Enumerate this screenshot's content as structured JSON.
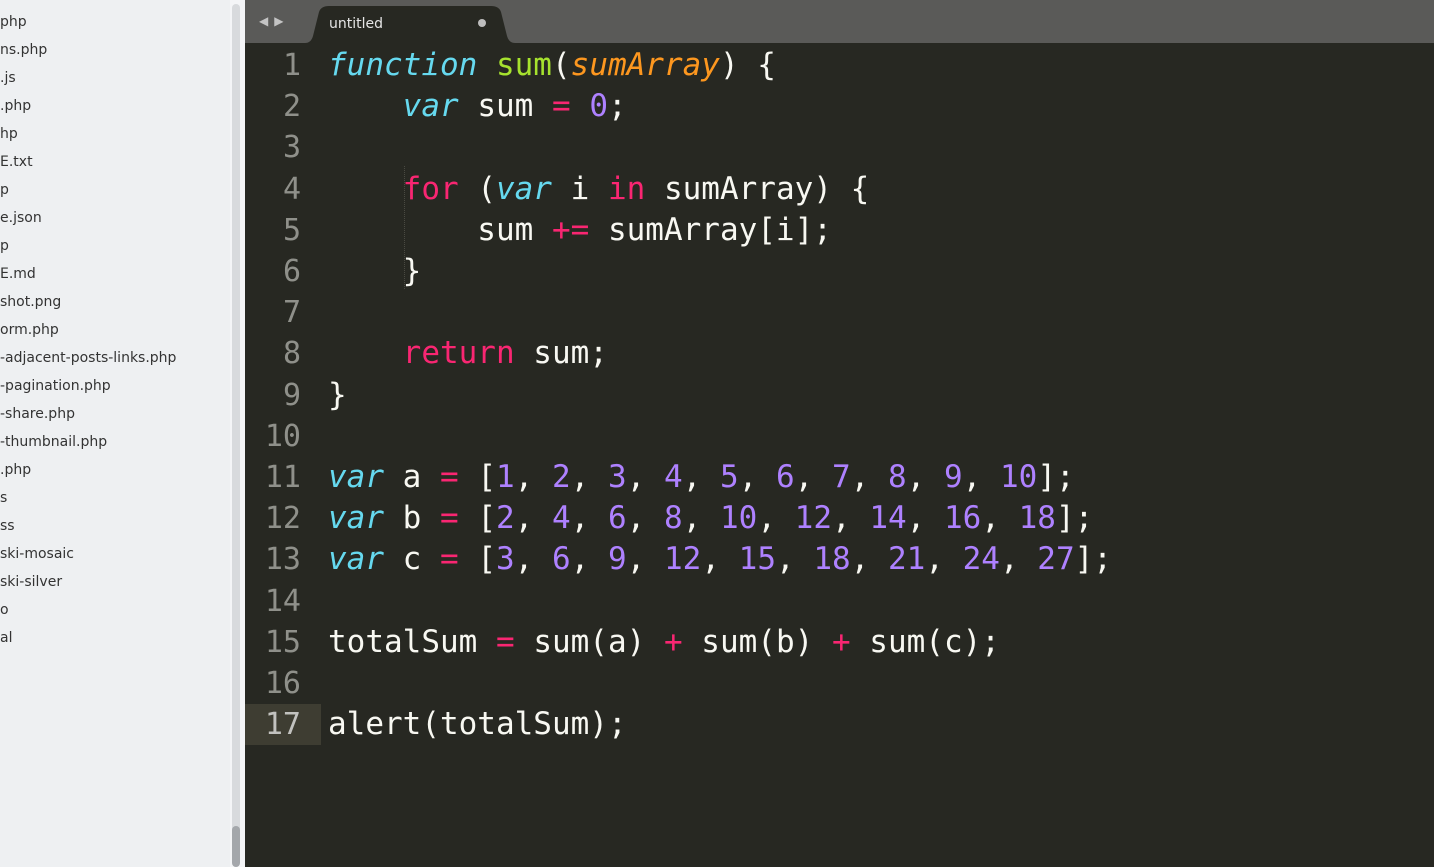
{
  "sidebar": {
    "items": [
      "php",
      "ns.php",
      ".js",
      ".php",
      "hp",
      "E.txt",
      "p",
      "e.json",
      "p",
      "E.md",
      "shot.png",
      "orm.php",
      "-adjacent-posts-links.php",
      "-pagination.php",
      "-share.php",
      "-thumbnail.php",
      ".php",
      "s",
      "ss",
      "ski-mosaic",
      "ski-silver",
      "o",
      "al"
    ]
  },
  "tabbar": {
    "back_arrow": "◀",
    "forward_arrow": "▶",
    "tab_title": "untitled",
    "tab_modified_icon": "dot-icon"
  },
  "editor": {
    "current_line": 17,
    "line_numbers": [
      "1",
      "2",
      "3",
      "4",
      "5",
      "6",
      "7",
      "8",
      "9",
      "10",
      "11",
      "12",
      "13",
      "14",
      "15",
      "16",
      "17"
    ],
    "lines": [
      [
        {
          "t": "function",
          "c": "kw-storage"
        },
        {
          "t": " "
        },
        {
          "t": "sum",
          "c": "fn"
        },
        {
          "t": "("
        },
        {
          "t": "sumArray",
          "c": "param"
        },
        {
          "t": ") {"
        }
      ],
      [
        {
          "t": "    "
        },
        {
          "t": "var",
          "c": "kw-storage"
        },
        {
          "t": " sum "
        },
        {
          "t": "=",
          "c": "op"
        },
        {
          "t": " "
        },
        {
          "t": "0",
          "c": "num"
        },
        {
          "t": ";"
        }
      ],
      [],
      [
        {
          "t": "    "
        },
        {
          "t": "for",
          "c": "kw"
        },
        {
          "t": " ("
        },
        {
          "t": "var",
          "c": "kw-storage"
        },
        {
          "t": " i "
        },
        {
          "t": "in",
          "c": "kw"
        },
        {
          "t": " sumArray) {"
        }
      ],
      [
        {
          "t": "        sum "
        },
        {
          "t": "+=",
          "c": "op"
        },
        {
          "t": " sumArray[i];"
        }
      ],
      [
        {
          "t": "    }"
        }
      ],
      [],
      [
        {
          "t": "    "
        },
        {
          "t": "return",
          "c": "kw"
        },
        {
          "t": " sum;"
        }
      ],
      [
        {
          "t": "}"
        }
      ],
      [],
      [
        {
          "t": "var",
          "c": "kw-storage"
        },
        {
          "t": " a "
        },
        {
          "t": "=",
          "c": "op"
        },
        {
          "t": " ["
        },
        {
          "t": "1",
          "c": "num"
        },
        {
          "t": ", "
        },
        {
          "t": "2",
          "c": "num"
        },
        {
          "t": ", "
        },
        {
          "t": "3",
          "c": "num"
        },
        {
          "t": ", "
        },
        {
          "t": "4",
          "c": "num"
        },
        {
          "t": ", "
        },
        {
          "t": "5",
          "c": "num"
        },
        {
          "t": ", "
        },
        {
          "t": "6",
          "c": "num"
        },
        {
          "t": ", "
        },
        {
          "t": "7",
          "c": "num"
        },
        {
          "t": ", "
        },
        {
          "t": "8",
          "c": "num"
        },
        {
          "t": ", "
        },
        {
          "t": "9",
          "c": "num"
        },
        {
          "t": ", "
        },
        {
          "t": "10",
          "c": "num"
        },
        {
          "t": "];"
        }
      ],
      [
        {
          "t": "var",
          "c": "kw-storage"
        },
        {
          "t": " b "
        },
        {
          "t": "=",
          "c": "op"
        },
        {
          "t": " ["
        },
        {
          "t": "2",
          "c": "num"
        },
        {
          "t": ", "
        },
        {
          "t": "4",
          "c": "num"
        },
        {
          "t": ", "
        },
        {
          "t": "6",
          "c": "num"
        },
        {
          "t": ", "
        },
        {
          "t": "8",
          "c": "num"
        },
        {
          "t": ", "
        },
        {
          "t": "10",
          "c": "num"
        },
        {
          "t": ", "
        },
        {
          "t": "12",
          "c": "num"
        },
        {
          "t": ", "
        },
        {
          "t": "14",
          "c": "num"
        },
        {
          "t": ", "
        },
        {
          "t": "16",
          "c": "num"
        },
        {
          "t": ", "
        },
        {
          "t": "18",
          "c": "num"
        },
        {
          "t": "];"
        }
      ],
      [
        {
          "t": "var",
          "c": "kw-storage"
        },
        {
          "t": " c "
        },
        {
          "t": "=",
          "c": "op"
        },
        {
          "t": " ["
        },
        {
          "t": "3",
          "c": "num"
        },
        {
          "t": ", "
        },
        {
          "t": "6",
          "c": "num"
        },
        {
          "t": ", "
        },
        {
          "t": "9",
          "c": "num"
        },
        {
          "t": ", "
        },
        {
          "t": "12",
          "c": "num"
        },
        {
          "t": ", "
        },
        {
          "t": "15",
          "c": "num"
        },
        {
          "t": ", "
        },
        {
          "t": "18",
          "c": "num"
        },
        {
          "t": ", "
        },
        {
          "t": "21",
          "c": "num"
        },
        {
          "t": ", "
        },
        {
          "t": "24",
          "c": "num"
        },
        {
          "t": ", "
        },
        {
          "t": "27",
          "c": "num"
        },
        {
          "t": "];"
        }
      ],
      [],
      [
        {
          "t": "totalSum "
        },
        {
          "t": "=",
          "c": "op"
        },
        {
          "t": " sum(a) "
        },
        {
          "t": "+",
          "c": "op"
        },
        {
          "t": " sum(b) "
        },
        {
          "t": "+",
          "c": "op"
        },
        {
          "t": " sum(c);"
        }
      ],
      [],
      [
        {
          "t": "alert(totalSum);"
        }
      ]
    ]
  },
  "colors": {
    "editor_background": "#272822",
    "keyword_pink": "#f92672",
    "storage_cyan": "#66d9ef",
    "function_green": "#a6e22e",
    "parameter_orange": "#fd971f",
    "number_purple": "#ae81ff",
    "text": "#f8f8f2",
    "sidebar_background": "#eef0f2",
    "tabbar_background": "#5a5a58"
  }
}
